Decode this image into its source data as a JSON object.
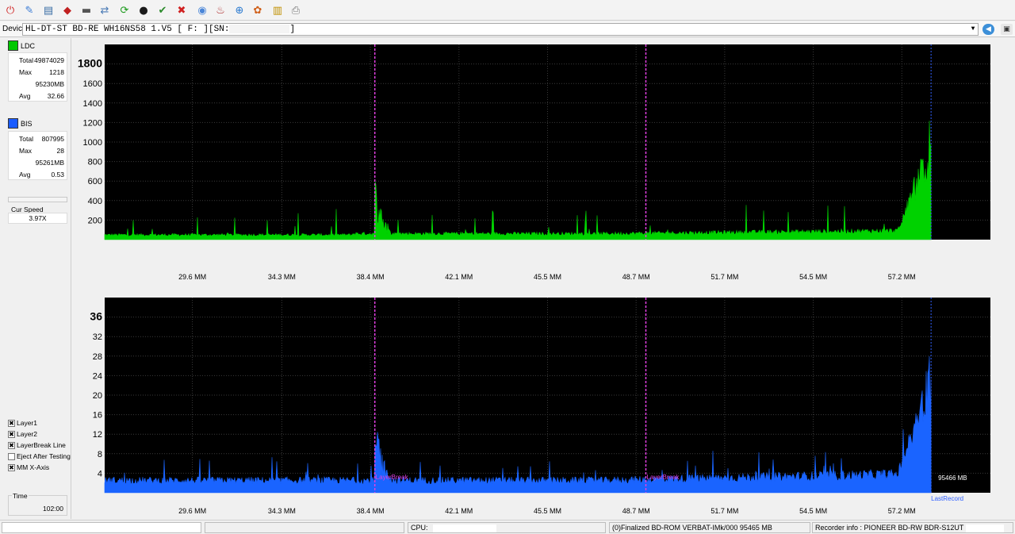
{
  "toolbar": {
    "icons": [
      "power-icon",
      "drive-info-icon",
      "scan-disc-icon",
      "erase-icon",
      "eject-icon",
      "transfer-icon",
      "refresh-icon",
      "start-test-icon",
      "verify-icon",
      "stop-icon",
      "disc-icon",
      "burn-icon",
      "copy-icon",
      "settings-icon",
      "chart-icon",
      "print-icon"
    ]
  },
  "device": {
    "label": "Device:",
    "value": "HL-DT-ST BD-RE  WH16NS58  1.V5 [ F: ][SN:",
    "suffix": "]"
  },
  "left": {
    "ldc": {
      "name": "LDC",
      "color": "#00c800",
      "total_k": "Total",
      "total_v": "49874029",
      "max_k": "Max",
      "max_v": "1218",
      "max_pos": "95230MB",
      "avg_k": "Avg",
      "avg_v": "32.66"
    },
    "bis": {
      "name": "BIS",
      "color": "#1a5cff",
      "total_k": "Total",
      "total_v": "807995",
      "max_k": "Max",
      "max_v": "28",
      "max_pos": "95261MB",
      "avg_k": "Avg",
      "avg_v": "0.53"
    },
    "speed_label": "Cur Speed",
    "speed_value": "3.97X",
    "checks": [
      {
        "label": "Layer1",
        "checked": true
      },
      {
        "label": "Layer2",
        "checked": true
      },
      {
        "label": "LayerBreak Line",
        "checked": true
      },
      {
        "label": "Eject After Testing",
        "checked": false
      },
      {
        "label": "MM X-Axis",
        "checked": true
      }
    ],
    "time_label": "Time",
    "time_value": "102:00"
  },
  "chart_data": [
    {
      "type": "area",
      "name": "LDC",
      "ylim": [
        0,
        2000
      ],
      "yticks": [
        200,
        400,
        600,
        800,
        1000,
        1200,
        1400,
        1600,
        1800
      ],
      "ytick_labels": [
        "200",
        "400",
        "600",
        "800",
        "1000",
        "1200",
        "1400",
        "1600",
        "1800"
      ],
      "xticks": [
        "29.6 MM",
        "34.3 MM",
        "38.4 MM",
        "42.1 MM",
        "45.5 MM",
        "48.7 MM",
        "51.7 MM",
        "54.5 MM",
        "57.2 MM"
      ],
      "xlim_frac": [
        0,
        0.933
      ],
      "layer_breaks_frac": [
        0.305,
        0.611
      ],
      "end_frac": 0.933,
      "color": "#00d200",
      "baseline": 60,
      "max": 1218
    },
    {
      "type": "area",
      "name": "BIS",
      "ylim": [
        0,
        40
      ],
      "yticks": [
        4,
        8,
        12,
        16,
        20,
        24,
        28,
        32,
        36
      ],
      "ytick_labels": [
        "4",
        "8",
        "12",
        "16",
        "20",
        "24",
        "28",
        "32",
        "36"
      ],
      "xticks": [
        "29.6 MM",
        "34.3 MM",
        "38.4 MM",
        "42.1 MM",
        "45.5 MM",
        "48.7 MM",
        "51.7 MM",
        "54.5 MM",
        "57.2 MM"
      ],
      "layer_breaks_frac": [
        0.305,
        0.611
      ],
      "end_frac": 0.933,
      "color": "#1a64ff",
      "baseline": 2.5,
      "max": 28,
      "layerbreak_text": "LayerBreak",
      "end_text": "LastRecord",
      "end_value_text": "95466 MB"
    }
  ],
  "status": {
    "cpu_label": "CPU:",
    "disc": "(0)Finalized  BD-ROM  VERBAT-IMk/000  95465 MB",
    "recorder": "Recorder info : PIONEER      BD-RW  BDR-S12UT"
  }
}
